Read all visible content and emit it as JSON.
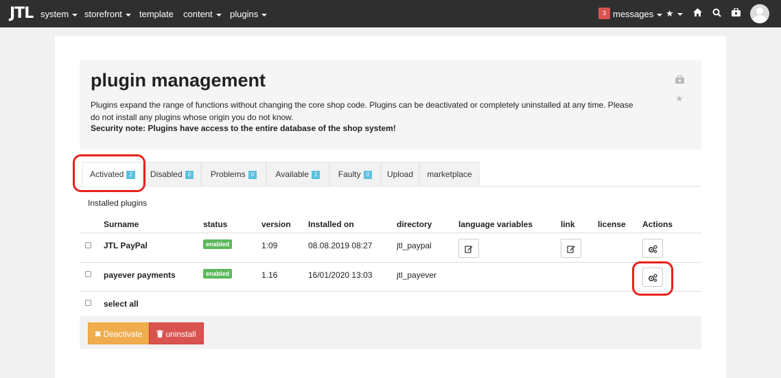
{
  "nav": {
    "logo": "JTL",
    "items": [
      "system",
      "storefront",
      "template",
      "content",
      "plugins"
    ],
    "messages_count": "3",
    "messages_label": "messages",
    "icons": [
      "star-icon",
      "home-icon",
      "search-icon",
      "briefcase-icon",
      "avatar-icon"
    ]
  },
  "header": {
    "title": "plugin management",
    "description": "Plugins expand the range of functions without changing the core shop code. Plugins can be deactivated or completely uninstalled at any time. Please do not install any plugins whose origin you do not know.",
    "security_note": "Security note: Plugins have access to the entire database of the shop system!"
  },
  "tabs": [
    {
      "label": "Activated",
      "count": "2"
    },
    {
      "label": "Disabled",
      "count": "0"
    },
    {
      "label": "Problems",
      "count": "0"
    },
    {
      "label": "Available",
      "count": "1"
    },
    {
      "label": "Faulty",
      "count": "0"
    },
    {
      "label": "Upload",
      "count": ""
    },
    {
      "label": "marketplace",
      "count": ""
    }
  ],
  "table": {
    "section_label": "Installed plugins",
    "columns": [
      "Surname",
      "status",
      "version",
      "Installed on",
      "directory",
      "language variables",
      "link",
      "license",
      "Actions"
    ],
    "rows": [
      {
        "name": "JTL PayPal",
        "status": "enabled",
        "version": "1:09",
        "installed_on": "08.08.2019 08:27",
        "directory": "jtl_paypal"
      },
      {
        "name": "payever payments",
        "status": "enabled",
        "version": "1.16",
        "installed_on": "16/01/2020 13:03",
        "directory": "jtl_payever"
      }
    ],
    "select_all": "select all"
  },
  "actions": {
    "deactivate": "Deactivate",
    "uninstall": "uninstall"
  },
  "colors": {
    "accent_annotation": "#e8211b",
    "enabled": "#5cb85c",
    "deactivate": "#f0ad4e",
    "uninstall": "#d9534f",
    "badge_count": "#5bc0de"
  }
}
